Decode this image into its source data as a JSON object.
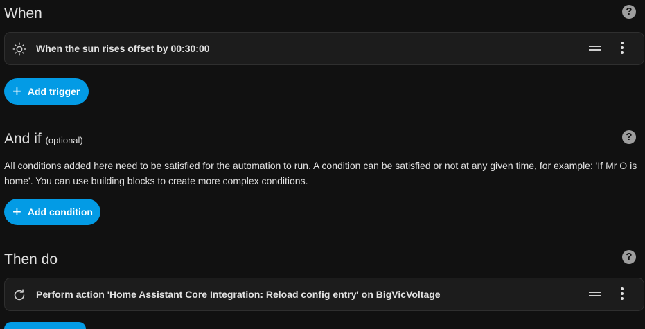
{
  "when": {
    "title": "When",
    "help": "?",
    "trigger": {
      "icon": "sun-icon",
      "text": "When the sun rises offset by 00:30:00"
    },
    "add_button": {
      "icon": "plus-icon",
      "label": "Add trigger"
    }
  },
  "and_if": {
    "title": "And if",
    "optional": "(optional)",
    "help": "?",
    "description": "All conditions added here need to be satisfied for the automation to run. A condition can be satisfied or not at any given time, for example: 'If Mr O is home'. You can use building blocks to create more complex conditions.",
    "add_button": {
      "icon": "plus-icon",
      "label": "Add condition"
    }
  },
  "then_do": {
    "title": "Then do",
    "help": "?",
    "action": {
      "icon": "refresh-icon",
      "text": "Perform action 'Home Assistant Core Integration: Reload config entry' on BigVicVoltage"
    }
  },
  "colors": {
    "background": "#111111",
    "card": "#1c1c1c",
    "accent": "#039be5",
    "text": "#e1e1e1"
  }
}
